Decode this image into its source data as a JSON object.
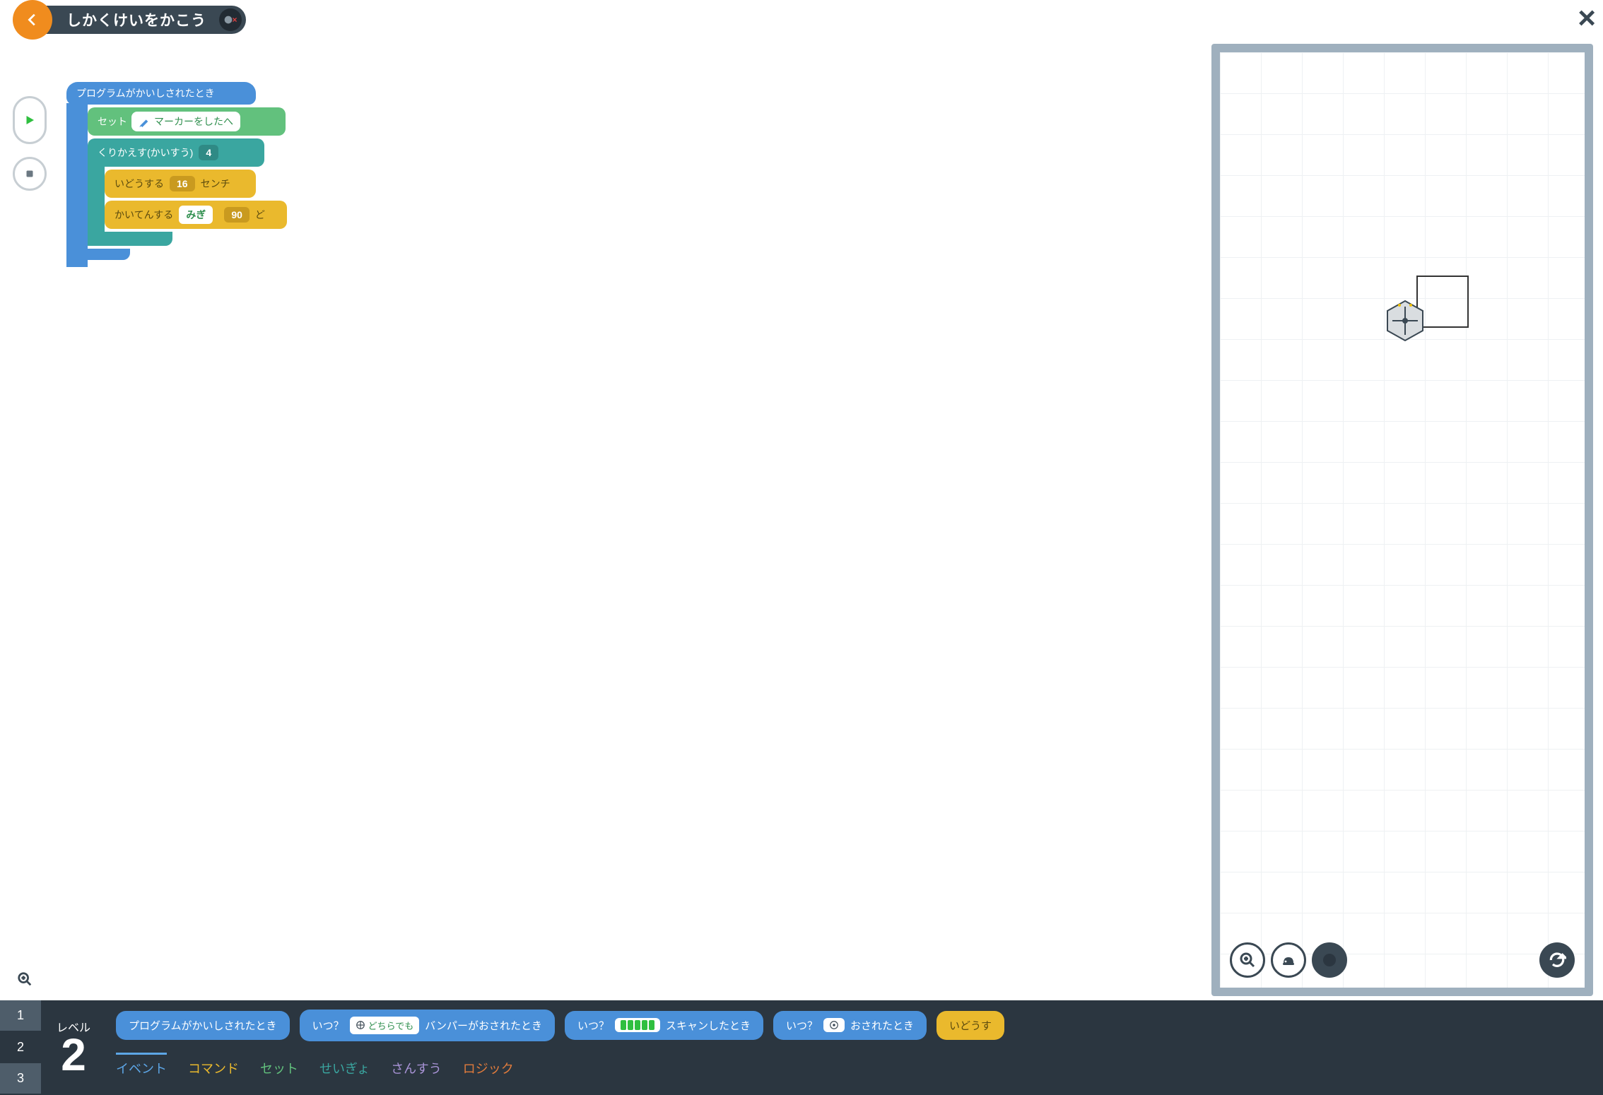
{
  "header": {
    "title": "しかくけいをかこう"
  },
  "blocks": {
    "hat": "プログラムがかいしされたとき",
    "set_label": "セット",
    "set_pill": "マーカーをしたへ",
    "repeat_label": "くりかえす(かいすう)",
    "repeat_count": "4",
    "move_label_pre": "いどうする",
    "move_value": "16",
    "move_label_post": "センチ",
    "turn_label_pre": "かいてんする",
    "turn_dir": "みぎ",
    "turn_deg": "90",
    "turn_label_post": "ど"
  },
  "level": {
    "label": "レベル",
    "current": "2",
    "tabs": [
      "1",
      "2",
      "3"
    ]
  },
  "palette": {
    "blocks": [
      {
        "text": "プログラムがかいしされたとき"
      },
      {
        "pre": "いつ？",
        "pill": "どちらでも",
        "post": "バンパーがおされたとき",
        "icon": "bumper"
      },
      {
        "pre": "いつ？",
        "bars": true,
        "post": "スキャンしたとき"
      },
      {
        "pre": "いつ？",
        "pill": "",
        "post": "おされたとき",
        "icon": "touch"
      },
      {
        "yellow": true,
        "text": "いどうす"
      }
    ],
    "categories": {
      "event": "イベント",
      "command": "コマンド",
      "set": "セット",
      "ctrl": "せいぎょ",
      "math": "さんすう",
      "logic": "ロジック"
    }
  }
}
